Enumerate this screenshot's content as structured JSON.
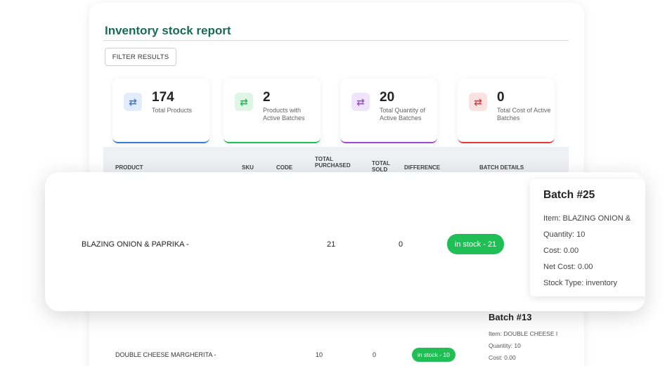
{
  "report": {
    "title": "Inventory stock report",
    "filter_label": "FILTER RESULTS"
  },
  "stats": [
    {
      "value": "174",
      "label": "Total Products",
      "icon": "swap-arrows-icon",
      "color": "#3a7bd5",
      "bg": "#e3ecfb"
    },
    {
      "value": "2",
      "label": "Products with Active Batches",
      "icon": "swap-arrows-icon",
      "color": "#1fbf55",
      "bg": "#dff6e6"
    },
    {
      "value": "20",
      "label": "Total Quantity of Active Batches",
      "icon": "swap-arrows-icon",
      "color": "#9b4dd6",
      "bg": "#f0e4fa"
    },
    {
      "value": "0",
      "label": "Total Cost of Active Batches",
      "icon": "swap-arrows-icon",
      "color": "#e03b3b",
      "bg": "#fbe2e2"
    }
  ],
  "table": {
    "headers": {
      "product": "PRODUCT",
      "sku": "SKU",
      "code": "CODE",
      "total_purchased": "TOTAL PURCHASED",
      "total_sold": "TOTAL SOLD",
      "difference": "DIFFERENCE",
      "batch_details": "BATCH DETAILS"
    },
    "rows": [
      {
        "product": "BLAZING ONION & PAPRIKA -",
        "total_purchased": "21",
        "total_sold": "0",
        "status": "in stock - 21",
        "batch": {
          "title": "Batch #25",
          "item": "Item: BLAZING ONION &",
          "quantity": "Quantity: 10",
          "cost": "Cost: 0.00",
          "net_cost": "Net Cost: 0.00",
          "stock_type": "Stock Type: inventory"
        }
      },
      {
        "product": "DOUBLE CHEESE MARGHERITA -",
        "total_purchased": "10",
        "total_sold": "0",
        "status": "in stock - 10",
        "batch": {
          "title": "Batch #13",
          "item": "Item: DOUBLE CHEESE I",
          "quantity": "Quantity: 10",
          "cost": "Cost: 0.00"
        }
      }
    ]
  },
  "colors": {
    "accent": "#1a6b55",
    "in_stock": "#1fbf55"
  }
}
